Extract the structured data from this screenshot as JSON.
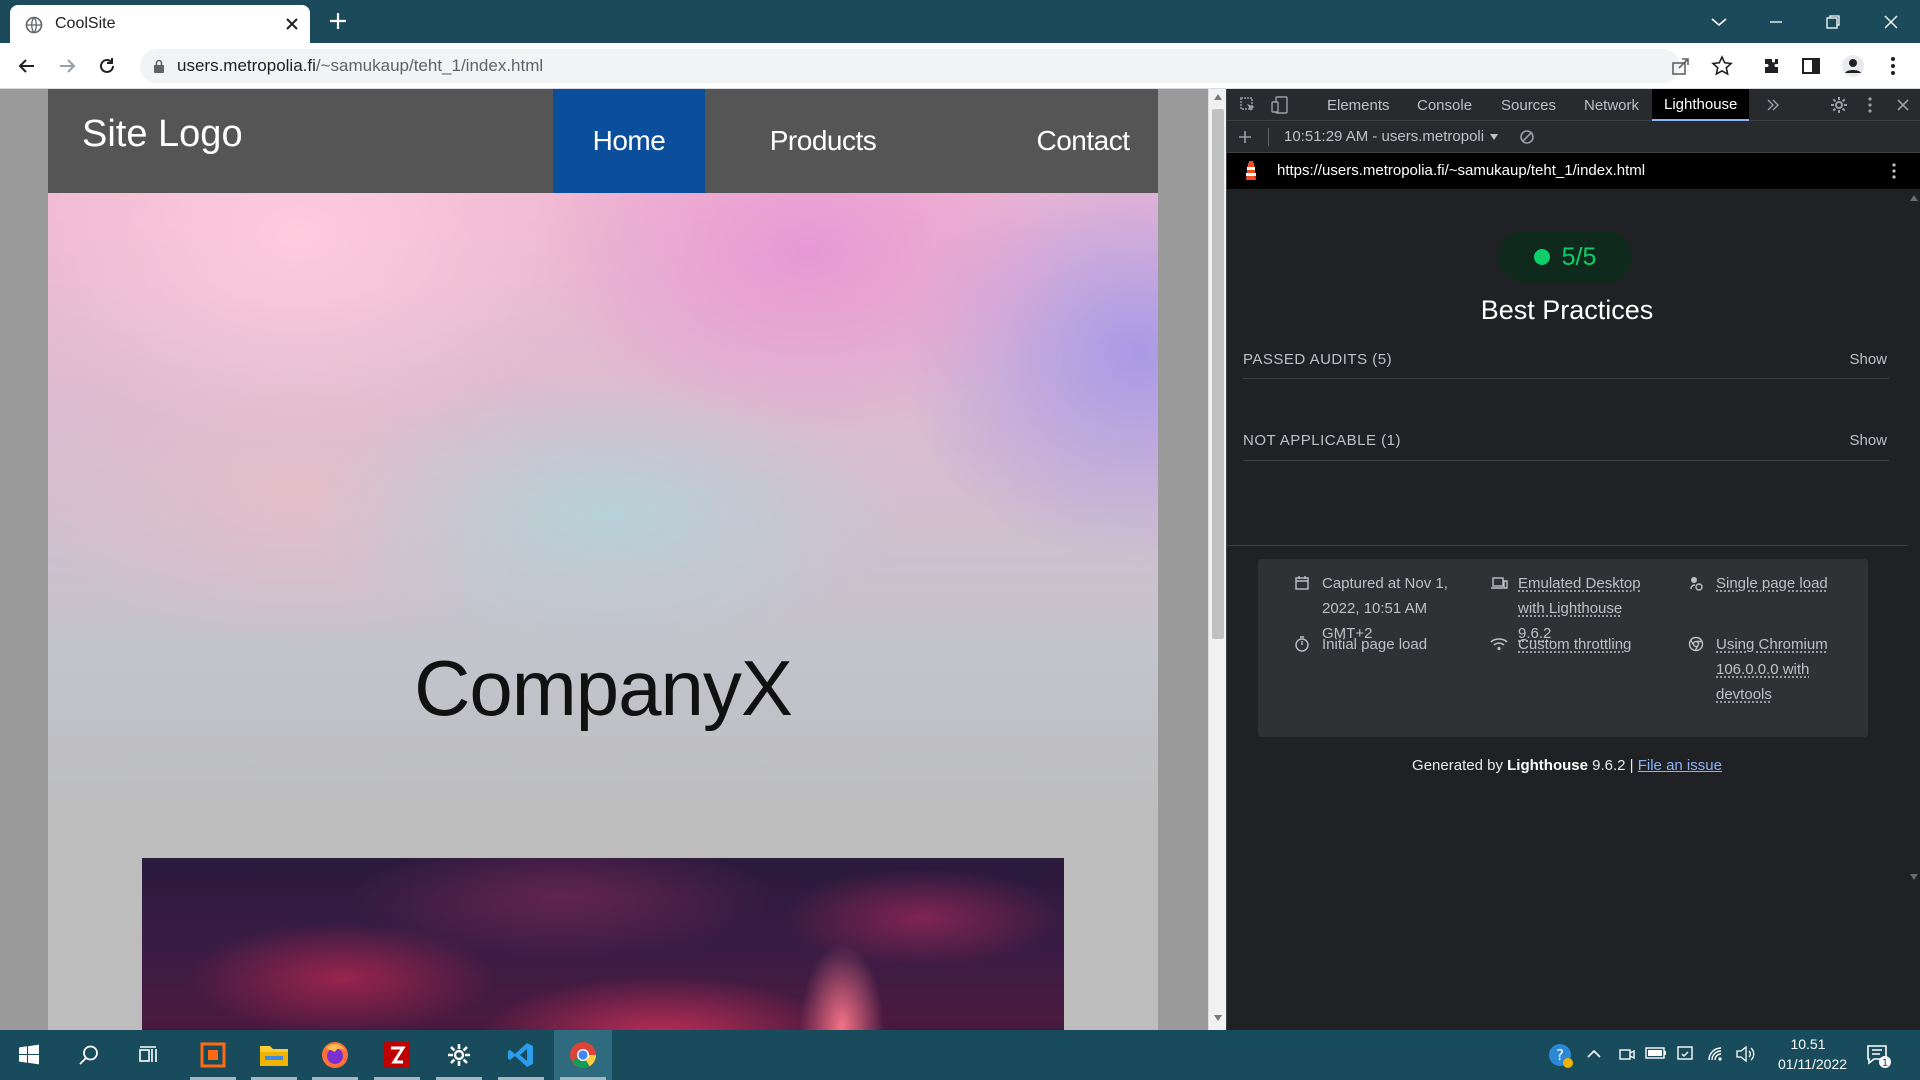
{
  "browser": {
    "tab_title": "CoolSite",
    "url_host": "users.metropolia.fi",
    "url_path": "/~samukaup/teht_1/index.html"
  },
  "site": {
    "logo": "Site Logo",
    "nav": [
      "Home",
      "Products",
      "Contact"
    ],
    "active_nav": "Home",
    "hero_title": "CompanyX"
  },
  "devtools": {
    "tabs": [
      "Elements",
      "Console",
      "Sources",
      "Network",
      "Lighthouse"
    ],
    "active_tab": "Lighthouse",
    "report_select": "10:51:29 AM - users.metropoli",
    "report_url": "https://users.metropolia.fi/~samukaup/teht_1/index.html",
    "score": "5/5",
    "category_title": "Best Practices",
    "groups": [
      {
        "title": "PASSED AUDITS (5)",
        "action": "Show"
      },
      {
        "title": "NOT APPLICABLE (1)",
        "action": "Show"
      }
    ],
    "env": {
      "captured": [
        "Captured at Nov 1,",
        "2022, 10:51 AM",
        "GMT+2"
      ],
      "device": [
        "Emulated Desktop",
        "with Lighthouse",
        "9.6.2"
      ],
      "load_mode": "Single page load",
      "initial": "Initial page load",
      "throttling": "Custom throttling",
      "chromium": [
        "Using Chromium",
        "106.0.0.0 with",
        "devtools"
      ]
    },
    "footer": {
      "prefix": "Generated by",
      "brand": "Lighthouse",
      "version": "9.6.2 |",
      "link": "File an issue"
    },
    "colors": {
      "pass": "#0cce6b",
      "accent": "#8ab4f8"
    }
  },
  "taskbar": {
    "time": "10.51",
    "date": "01/11/2022",
    "apps": [
      "start",
      "search",
      "task-view",
      "app-orange",
      "file-explorer",
      "firefox",
      "filezilla",
      "settings",
      "vscode",
      "chrome"
    ]
  }
}
